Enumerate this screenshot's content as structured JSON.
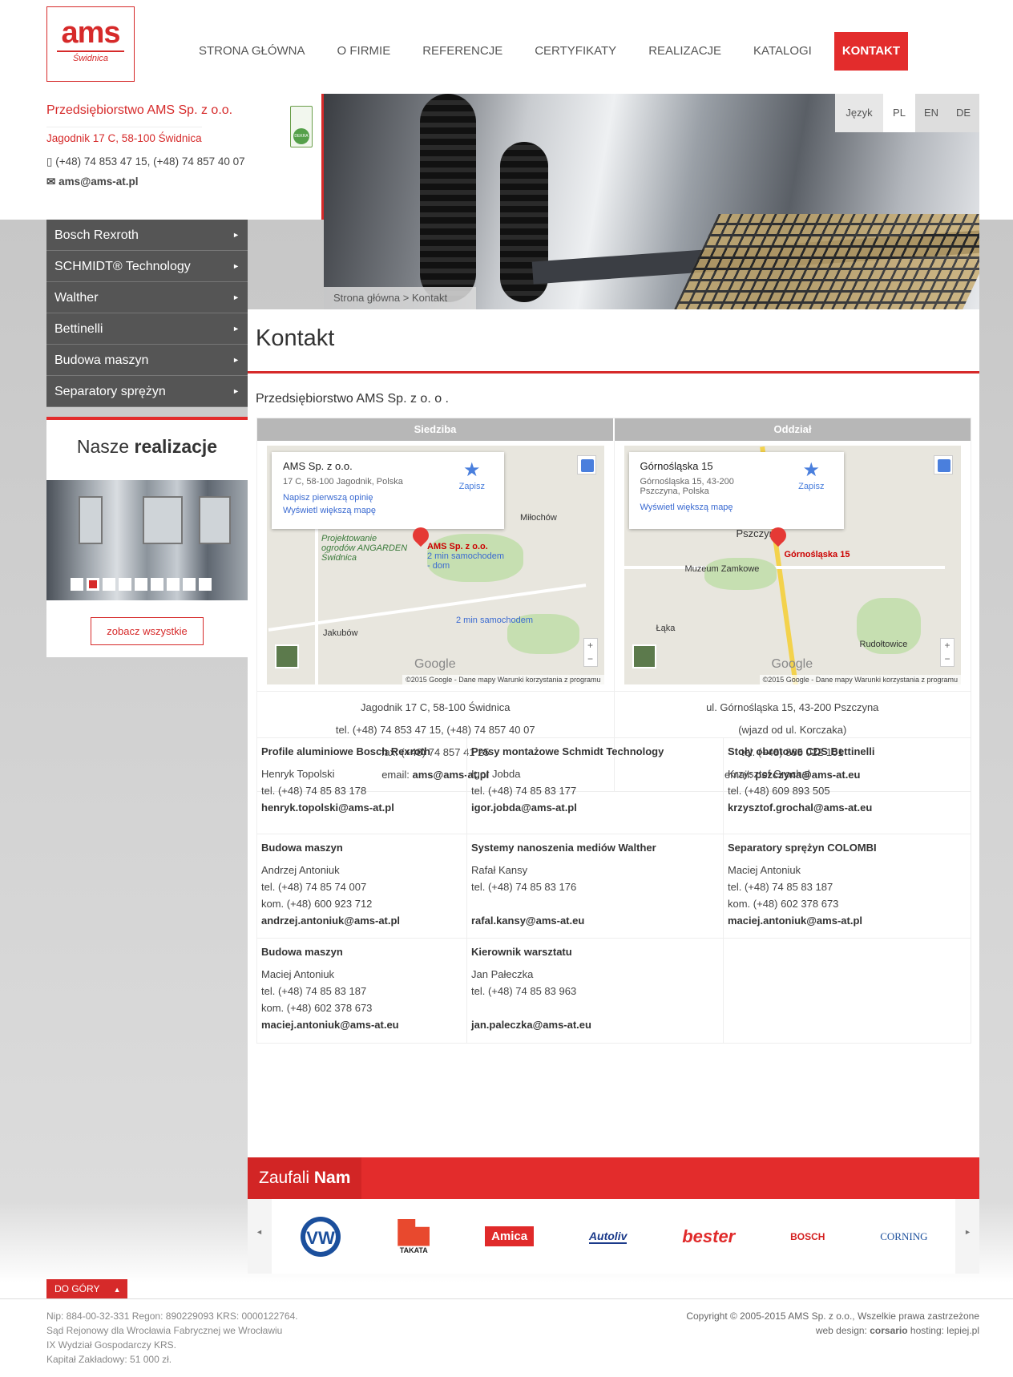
{
  "logo": {
    "brand": "ams",
    "city": "Świdnica"
  },
  "nav": [
    "STRONA GŁÓWNA",
    "O FIRMIE",
    "REFERENCJE",
    "CERTYFIKATY",
    "REALIZACJE",
    "KATALOGI",
    "KONTAKT"
  ],
  "info": {
    "company": "Przedsiębiorstwo AMS Sp. z o.o.",
    "address": "Jagodnik 17 C, 58-100 Świdnica",
    "phone": "(+48) 74 853 47 15, (+48) 74 857 40 07",
    "email": "ams@ams-at.pl",
    "cert": "DEKRA"
  },
  "lang": {
    "label": "Język",
    "items": [
      "PL",
      "EN",
      "DE"
    ],
    "active": "PL"
  },
  "breadcrumb": {
    "home": "Strona główna",
    "sep": ">",
    "current": "Kontakt"
  },
  "sidebar": [
    "Bosch Rexroth",
    "SCHMIDT® Technology",
    "Walther",
    "Bettinelli",
    "Budowa maszyn",
    "Separatory sprężyn"
  ],
  "realizacje": {
    "title_light": "Nasze",
    "title_bold": "realizacje",
    "button": "zobacz wszystkie"
  },
  "page": {
    "title": "Kontakt",
    "company": "Przedsiębiorstwo AMS Sp. z o. o ."
  },
  "locations": [
    {
      "header": "Siedziba",
      "map": {
        "place": "AMS Sp. z o.o.",
        "address": "17 C, 58-100 Jagodnik, Polska",
        "link1": "Napisz pierwszą opinię",
        "link2": "Wyświetl większą mapę",
        "save": "Zapisz",
        "pin_label": "AMS Sp. z o.o.",
        "pin_sub": "2 min samochodem - dom",
        "labels": [
          "Miłochów",
          "Projektowanie ogrodów ANGARDEN Świdnica",
          "2 min samochodem",
          "Jakubów"
        ],
        "google": "Google",
        "copyright": "©2015 Google - Dane mapy   Warunki korzystania z programu"
      },
      "lines": [
        "Jagodnik 17 C, 58-100 Świdnica",
        "tel.  (+48) 74 853 47 15, (+48) 74 857 40 07",
        "fax. (+48) 74 857 41 25"
      ],
      "email_label": "email:",
      "email": "ams@ams-at.pl"
    },
    {
      "header": "Oddział",
      "map": {
        "place": "Górnośląska 15",
        "address": "Górnośląska 15, 43-200 Pszczyna, Polska",
        "link1": "",
        "link2": "Wyświetl większą mapę",
        "save": "Zapisz",
        "pin_label": "Górnośląska 15",
        "pin_sub": "",
        "labels": [
          "Pszczyn",
          "Muzeum Zamkowe",
          "Łąka",
          "Rudołtowice"
        ],
        "google": "Google",
        "copyright": "©2015 Google - Dane mapy   Warunki korzystania z programu"
      },
      "lines": [
        "ul. Górnośląska 15, 43-200 Pszczyna",
        "(wjazd od ul. Korczaka)",
        "tel. (+48) 885 022 101"
      ],
      "email_label": "email:",
      "email": "pszczyna@ams-at.eu"
    }
  ],
  "contacts": [
    [
      {
        "title": "Profile aluminiowe  Bosch Rexroth",
        "name": "Henryk Topolski",
        "tel": "tel. (+48) 74 85 83 178",
        "kom": "",
        "email": "henryk.topolski@ams-at.pl"
      },
      {
        "title": "Prasy montażowe Schmidt Technology",
        "name": "Igor Jobda",
        "tel": "tel. (+48) 74 85 83 177",
        "kom": "",
        "email": "igor.jobda@ams-at.pl"
      },
      {
        "title": "Stoły obrotowe CDS Bettinelli",
        "name": "Krzysztof Grochal",
        "tel": "tel. (+48) 609 893 505",
        "kom": "",
        "email": "krzysztof.grochal@ams-at.eu"
      }
    ],
    [
      {
        "title": "Budowa maszyn",
        "name": "Andrzej Antoniuk",
        "tel": "tel. (+48) 74 85 74 007",
        "kom": "kom. (+48) 600 923 712",
        "email": "andrzej.antoniuk@ams-at.pl"
      },
      {
        "title": "Systemy nanoszenia mediów Walther",
        "name": "Rafał Kansy",
        "tel": "tel. (+48) 74 85 83 176",
        "kom": "",
        "email": "rafal.kansy@ams-at.eu"
      },
      {
        "title": "Separatory sprężyn COLOMBI",
        "name": "Maciej Antoniuk",
        "tel": "tel. (+48) 74 85 83 187",
        "kom": "kom. (+48) 602 378 673",
        "email": "maciej.antoniuk@ams-at.pl"
      }
    ],
    [
      {
        "title": "Budowa maszyn",
        "name": "Maciej Antoniuk",
        "tel": "tel. (+48) 74 85 83 187",
        "kom": "kom. (+48) 602 378 673",
        "email": "maciej.antoniuk@ams-at.eu"
      },
      {
        "title": "Kierownik warsztatu",
        "name": "Jan Pałeczka",
        "tel": "tel. (+48) 74 85 83 963",
        "kom": "",
        "email": "jan.paleczka@ams-at.eu"
      },
      {
        "title": "",
        "name": "",
        "tel": "",
        "kom": "",
        "email": ""
      }
    ]
  ],
  "trust": {
    "light": "Zaufali",
    "bold": "Nam",
    "logos": [
      "VW",
      "TAKATA",
      "Amica",
      "Autoliv",
      "bester",
      "BOSCH",
      "CORNING"
    ]
  },
  "top_button": "DO GÓRY",
  "footer": {
    "left": [
      "Nip: 884-00-32-331 Regon: 890229093 KRS: 0000122764.",
      "Sąd Rejonowy dla Wrocławia Fabrycznej we Wrocławiu",
      "IX Wydział Gospodarczy KRS.",
      "Kapitał Zakładowy: 51 000 zł."
    ],
    "copyright": "Copyright © 2005-2015 AMS Sp. z o.o., Wszelkie prawa zastrzeżone",
    "webdesign_label": "web design:",
    "webdesign": "corsario",
    "hosting_label": "hosting:",
    "hosting": "lepiej.pl"
  },
  "colors": {
    "accent": "#e32c2c",
    "sidebar": "#555555"
  }
}
